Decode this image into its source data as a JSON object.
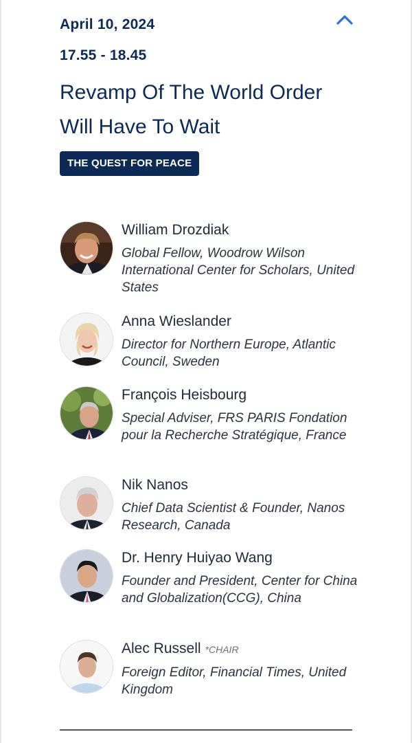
{
  "session": {
    "date": "April 10, 2024",
    "time": "17.55 - 18.45",
    "title": "Revamp Of The World Order Will Have To Wait",
    "tag": "THE QUEST FOR PEACE",
    "collapse_icon": "chevron-up-icon"
  },
  "colors": {
    "accent": "#0b2a55",
    "chevron": "#2f6fd6"
  },
  "speakers": [
    {
      "name": "William Drozdiak",
      "chair": "",
      "role": "Global Fellow, Woodrow Wilson International Center for Scholars, United States"
    },
    {
      "name": "Anna Wieslander",
      "chair": "",
      "role": "Director for Northern Europe, Atlantic Council, Sweden"
    },
    {
      "name": "François Heisbourg",
      "chair": "",
      "role": "Special Adviser, FRS PARIS Fondation pour la Recherche Stratégique, France"
    },
    {
      "name": "Nik Nanos",
      "chair": "",
      "role": "Chief Data Scientist & Founder, Nanos Research, Canada"
    },
    {
      "name": "Dr. Henry Huiyao Wang",
      "chair": "",
      "role": "Founder and President, Center for China and Globalization(CCG), China"
    },
    {
      "name": "Alec Russell",
      "chair": "*CHAIR",
      "role": "Foreign Editor, Financial Times, United Kingdom"
    }
  ]
}
